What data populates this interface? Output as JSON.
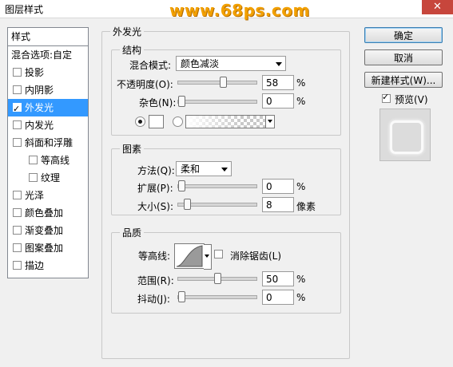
{
  "window": {
    "title": "图层样式",
    "watermark": "www.68ps.com",
    "close": "✕"
  },
  "style_list": {
    "header": "样式",
    "blend_options": "混合选项:自定",
    "items": [
      {
        "label": "投影",
        "checked": false
      },
      {
        "label": "内阴影",
        "checked": false
      },
      {
        "label": "外发光",
        "checked": true,
        "selected": true
      },
      {
        "label": "内发光",
        "checked": false
      },
      {
        "label": "斜面和浮雕",
        "checked": false
      },
      {
        "label": "等高线",
        "checked": false
      },
      {
        "label": "纹理",
        "checked": false
      },
      {
        "label": "光泽",
        "checked": false
      },
      {
        "label": "颜色叠加",
        "checked": false
      },
      {
        "label": "渐变叠加",
        "checked": false
      },
      {
        "label": "图案叠加",
        "checked": false
      },
      {
        "label": "描边",
        "checked": false
      }
    ]
  },
  "panel": {
    "title": "外发光",
    "structure": {
      "title": "结构",
      "blend_mode_label": "混合模式:",
      "blend_mode_value": "颜色减淡",
      "opacity_label": "不透明度(O):",
      "opacity_value": "58",
      "noise_label": "杂色(N):",
      "noise_value": "0",
      "percent": "%"
    },
    "elements": {
      "title": "图素",
      "technique_label": "方法(Q):",
      "technique_value": "柔和",
      "spread_label": "扩展(P):",
      "spread_value": "0",
      "size_label": "大小(S):",
      "size_value": "8",
      "pixels": "像素",
      "percent": "%"
    },
    "quality": {
      "title": "品质",
      "contour_label": "等高线:",
      "antialias_label": "消除锯齿(L)",
      "range_label": "范围(R):",
      "range_value": "50",
      "jitter_label": "抖动(J):",
      "jitter_value": "0",
      "percent": "%"
    }
  },
  "buttons": {
    "ok": "确定",
    "cancel": "取消",
    "new_style": "新建样式(W)...",
    "preview": "预览(V)"
  },
  "levels": {
    "opacity": 58,
    "noise": 0,
    "spread": 0,
    "size": 8,
    "range": 50,
    "jitter": 0
  }
}
